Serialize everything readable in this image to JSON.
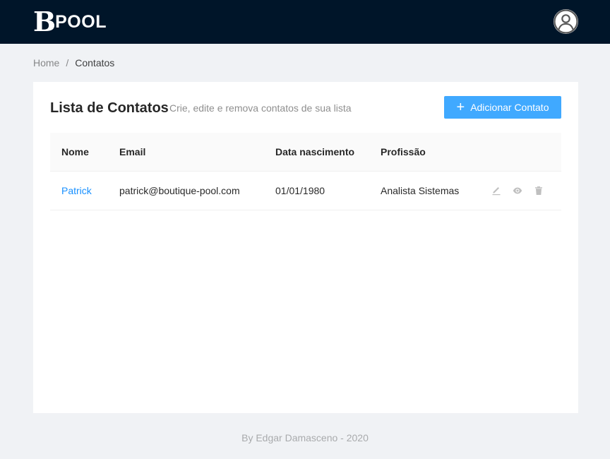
{
  "header": {
    "logo_b": "B",
    "logo_pool": "POOL",
    "avatar_icon": "user-circle-icon"
  },
  "breadcrumb": {
    "home": "Home",
    "separator": "/",
    "current": "Contatos"
  },
  "card": {
    "title": "Lista de Contatos",
    "subtitle": "Crie, edite e remova contatos de sua lista",
    "add_button": {
      "icon": "plus-icon",
      "label": "Adicionar Contato"
    }
  },
  "table": {
    "columns": [
      "Nome",
      "Email",
      "Data nascimento",
      "Profissão"
    ],
    "rows": [
      {
        "nome": "Patrick",
        "email": "patrick@boutique-pool.com",
        "data_nascimento": "01/01/1980",
        "profissao": "Analista Sistemas",
        "actions": [
          "edit-icon",
          "eye-icon",
          "trash-icon"
        ]
      }
    ]
  },
  "footer": {
    "text": "By Edgar Damasceno - 2020"
  },
  "colors": {
    "header_bg": "#001529",
    "page_bg": "#f0f2f5",
    "primary": "#40a9ff",
    "link": "#1890ff"
  }
}
